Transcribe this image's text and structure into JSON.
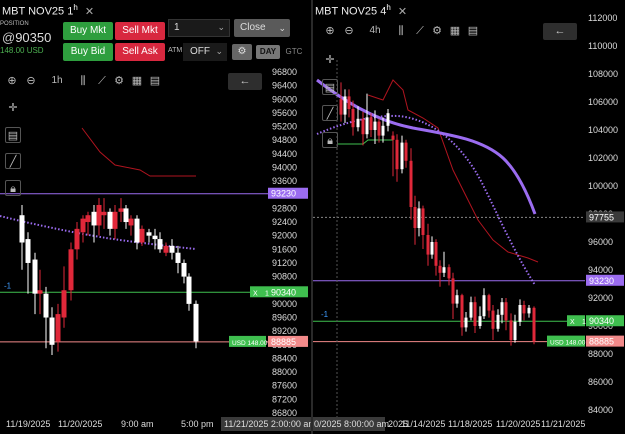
{
  "left": {
    "title": "MBT NOV25 1",
    "title_sup": "h",
    "position_label": "POSITION",
    "position_price_prefix": "@",
    "position_price": "90350",
    "position_usd": "148.00 USD",
    "order": {
      "buy_mkt": "Buy Mkt",
      "sell_mkt": "Sell Mkt",
      "buy_bid": "Buy Bid",
      "sell_ask": "Sell Ask",
      "qty_value": "1",
      "close_label": "Close",
      "atm_label": "ATM",
      "atm_value": "OFF",
      "day_label": "DAY",
      "gtc_label": "GTC"
    },
    "toolbar": {
      "interval": "1h"
    },
    "price_labels": [
      "96800",
      "96400",
      "96000",
      "95600",
      "95200",
      "94800",
      "94400",
      "94000",
      "93600",
      "93200",
      "92800",
      "92400",
      "92000",
      "91600",
      "91200",
      "90800",
      "90400",
      "90000",
      "89600",
      "89200",
      "88800",
      "88400",
      "88000",
      "87600",
      "87200",
      "86800"
    ],
    "markers": {
      "purple_value": "93230",
      "green_value": "90340",
      "red_value": "88885",
      "usd_tag": "USD 148.00",
      "x_tag": "X",
      "qty_tag": "1",
      "minus_one": "-1"
    },
    "time_labels": [
      "11/19/2025",
      "11/20/2025",
      "9:00 am",
      "5:00 pm"
    ],
    "crosshair_time": "11/21/2025 2:00:00 am"
  },
  "right": {
    "title": "MBT NOV25 4",
    "title_sup": "h",
    "toolbar": {
      "interval": "4h"
    },
    "price_labels": [
      "112000",
      "110000",
      "108000",
      "106000",
      "104000",
      "102000",
      "100000",
      "98000",
      "96000",
      "94000",
      "92000",
      "90000",
      "88000",
      "86000",
      "84000"
    ],
    "markers": {
      "gray_value": "97755",
      "purple_value": "93230",
      "green_value": "90340",
      "red_value": "88885",
      "usd_tag": "USD 148.00",
      "x_tag": "X",
      "qty_tag": "1",
      "minus_one": "-1"
    },
    "time_labels": [
      "0/2025 8:00:00 am",
      "2025",
      "11/14/2025",
      "11/18/2025",
      "11/20/2025",
      "11/21/2025"
    ]
  },
  "colors": {
    "buy": "#2e9e3e",
    "sell": "#d8283f",
    "candle_red": "#e0283a",
    "candle_white": "#ffffff",
    "purple": "#9b6cf0",
    "green_line": "#3fbf4f",
    "pink_line": "#f28a8a"
  }
}
